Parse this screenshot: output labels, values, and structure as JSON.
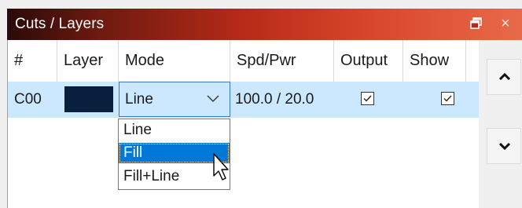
{
  "window": {
    "title": "Cuts / Layers",
    "float_icon": "float-window-icon",
    "close_glyph": "×"
  },
  "table": {
    "headers": [
      "#",
      "Layer",
      "Mode",
      "Spd/Pwr",
      "Output",
      "Show"
    ],
    "rows": [
      {
        "id": "C00",
        "layer_color": "#08203d",
        "mode": "Line",
        "spd_pwr": "100.0 / 20.0",
        "output_checked": true,
        "show_checked": true
      }
    ]
  },
  "mode_dropdown": {
    "options": [
      "Line",
      "Fill",
      "Fill+Line"
    ],
    "highlighted": "Fill"
  },
  "side_buttons": {
    "up_icon": "chevron-up-icon",
    "down_icon": "chevron-down-icon"
  },
  "colors": {
    "selection_row": "#cce8ff",
    "highlight": "#0078d7",
    "title_gradient_start": "#2a0a08",
    "title_gradient_end": "#e86a4a"
  }
}
